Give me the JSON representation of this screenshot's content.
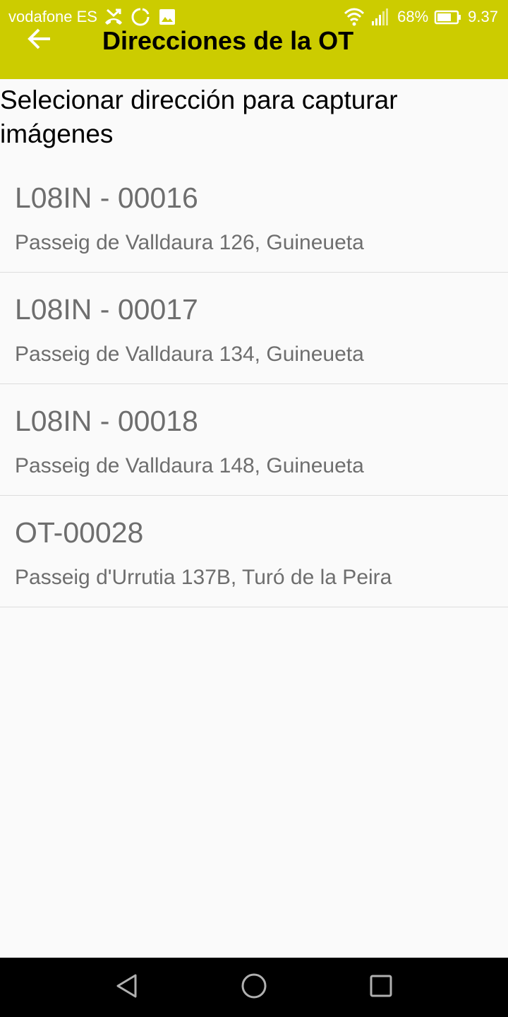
{
  "status_bar": {
    "carrier": "vodafone ES",
    "battery": "68%",
    "time": "9.37",
    "icons": [
      "missed-call-icon",
      "sync-icon",
      "image-icon",
      "wifi-icon",
      "signal-icon",
      "battery-icon"
    ]
  },
  "toolbar": {
    "title": "Direcciones de la OT",
    "back_icon": "arrow-back-icon",
    "background_color": "#cccc00"
  },
  "subtitle": "Selecionar dirección para capturar imágenes",
  "addresses": [
    {
      "code": "L08IN - 00016",
      "address": "Passeig de Valldaura 126, Guineueta"
    },
    {
      "code": "L08IN - 00017",
      "address": "Passeig de Valldaura 134, Guineueta"
    },
    {
      "code": "L08IN - 00018",
      "address": "Passeig de Valldaura 148, Guineueta"
    },
    {
      "code": "OT-00028",
      "address": "Passeig d'Urrutia 137B, Turó de la Peira"
    }
  ],
  "nav_bar": {
    "icons": [
      "back-triangle-icon",
      "home-circle-icon",
      "recents-square-icon"
    ]
  }
}
